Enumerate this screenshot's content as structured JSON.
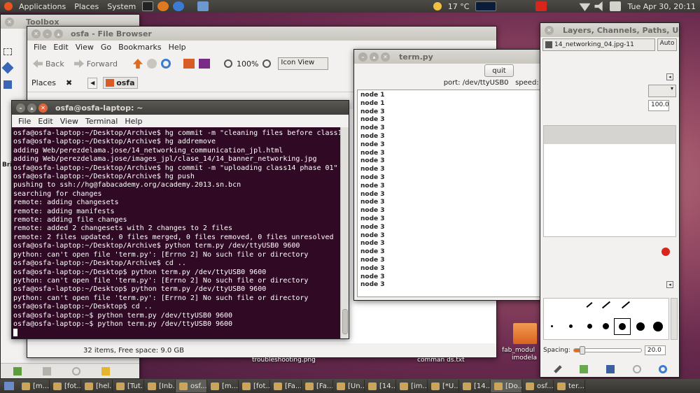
{
  "top_panel": {
    "menus": [
      "Applications",
      "Places",
      "System"
    ],
    "weather": "17 °C",
    "clock": "Tue Apr 30, 20:11"
  },
  "toolbox": {
    "title": "Toolbox",
    "side_label": "Bri"
  },
  "file_browser": {
    "title": "osfa - File Browser",
    "menu": [
      "File",
      "Edit",
      "View",
      "Go",
      "Bookmarks",
      "Help"
    ],
    "back": "Back",
    "forward": "Forward",
    "zoom": "100%",
    "view_mode": "Icon View",
    "places": "Places",
    "crumb": "osfa",
    "status": "32 items, Free space: 9.0 GB"
  },
  "terminal": {
    "title": "osfa@osfa-laptop: ~",
    "menu": [
      "File",
      "Edit",
      "View",
      "Terminal",
      "Help"
    ],
    "lines": [
      "osfa@osfa-laptop:~/Desktop/Archive$ hg commit -m \"cleaning files before class14\"",
      "osfa@osfa-laptop:~/Desktop/Archive$ hg addremove",
      "adding Web/perezdelama.jose/14_networking_communication_jpl.html",
      "adding Web/perezdelama.jose/images_jpl/clase_14/14_banner_networking.jpg",
      "osfa@osfa-laptop:~/Desktop/Archive$ hg commit -m \"uploading class14 phase 01\"",
      "osfa@osfa-laptop:~/Desktop/Archive$ hg push",
      "pushing to ssh://hg@fabacademy.org/academy.2013.sn.bcn",
      "searching for changes",
      "remote: adding changesets",
      "remote: adding manifests",
      "remote: adding file changes",
      "remote: added 2 changesets with 2 changes to 2 files",
      "remote: 2 files updated, 0 files merged, 0 files removed, 0 files unresolved",
      "osfa@osfa-laptop:~/Desktop/Archive$ python term.py /dev/ttyUSB0 9600",
      "python: can't open file 'term.py': [Errno 2] No such file or directory",
      "osfa@osfa-laptop:~/Desktop/Archive$ cd ..",
      "osfa@osfa-laptop:~/Desktop$ python term.py /dev/ttyUSB0 9600",
      "python: can't open file 'term.py': [Errno 2] No such file or directory",
      "osfa@osfa-laptop:~/Desktop$ python term.py /dev/ttyUSB0 9600",
      "python: can't open file 'term.py': [Errno 2] No such file or directory",
      "osfa@osfa-laptop:~/Desktop$ cd ..",
      "osfa@osfa-laptop:~$ python term.py /dev/ttyUSB0 9600",
      "osfa@osfa-laptop:~$ python term.py /dev/ttyUSB0 9600"
    ]
  },
  "termpy": {
    "title": "term.py",
    "quit_label": "quit",
    "status": "port: /dev/ttyUSB0   speed: 9600",
    "nodes": [
      "node 1",
      "node 1",
      "node 3",
      "node 3",
      "node 3",
      "node 3",
      "node 3",
      "node 3",
      "node 3",
      "node 3",
      "node 3",
      "node 3",
      "node 3",
      "node 3",
      "node 3",
      "node 3",
      "node 3",
      "node 3",
      "node 3",
      "node 3",
      "node 3",
      "node 3",
      "node 3",
      "node 3"
    ]
  },
  "layers": {
    "title": "Layers, Channels, Paths, Und",
    "image": "14_networking_04.jpg-11",
    "auto": "Auto",
    "opacity": "100.0",
    "spacing_label": "Spacing:",
    "spacing_value": "20.0"
  },
  "desktop": {
    "labels": [
      "fab_modul",
      "imodela",
      "troubleshooting.png",
      "comman ds.txt"
    ]
  },
  "taskbar": [
    "[m...",
    "[fot...",
    "[hel...",
    "[Tut...",
    "[Inb...",
    "osf...",
    "[m...",
    "[fot...",
    "[Fa...",
    "[Fa...",
    "[Un...",
    "[14...",
    "[im...",
    "[*U...",
    "[14...",
    "[Do...",
    "osf...",
    "ter..."
  ]
}
